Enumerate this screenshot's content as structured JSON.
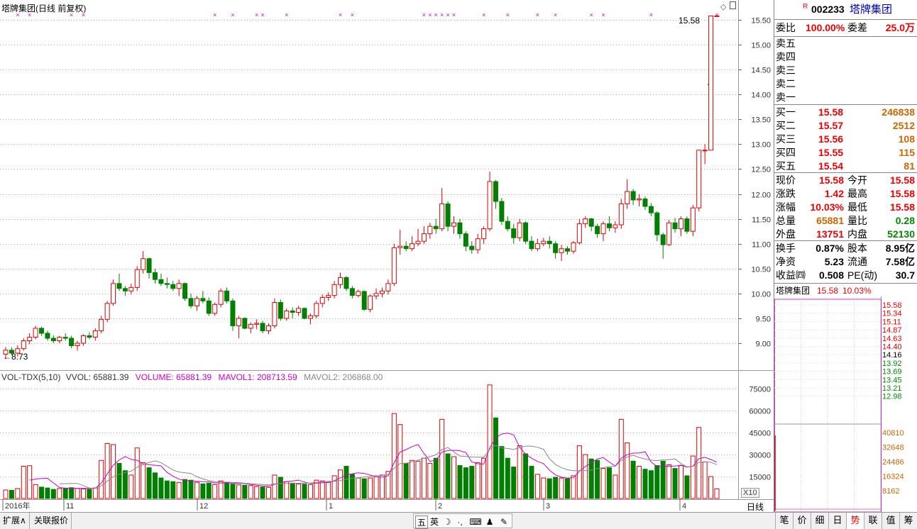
{
  "chart_title": "塔牌集团(日线 前复权)",
  "last_price_tag": "15.58",
  "low_marker": "8.73",
  "price_axis": [
    "15.50",
    "15.00",
    "14.50",
    "14.00",
    "13.50",
    "13.00",
    "12.50",
    "12.00",
    "11.50",
    "11.00",
    "10.50",
    "10.00",
    "9.50",
    "9.00"
  ],
  "volume_axis": [
    "75000",
    "60000",
    "45000",
    "30000",
    "15000"
  ],
  "volume_unit": "X10",
  "volume_legend": {
    "name": "VOL-TDX(5,10)",
    "vvol": "VVOL: 65881.39",
    "volume": "VOLUME: 65881.39",
    "mavol1": "MAVOL1: 208713.59",
    "mavol2": "MAVOL2: 206868.00"
  },
  "date_axis": [
    "2016年",
    "11",
    "12",
    "1",
    "2",
    "3",
    "4"
  ],
  "period_label": "日线",
  "colors": {
    "up": "#e00000",
    "down": "#008000",
    "ma1": "#cc00cc",
    "ma2": "#888888",
    "marker": "#cc00cc"
  },
  "chart_data": {
    "type": "candlestick",
    "title": "塔牌集团(日线 前复权)",
    "ylim": [
      8.6,
      15.65
    ],
    "volume_ylim": [
      0,
      80000
    ],
    "candles": [
      [
        8.78,
        8.92,
        8.7,
        8.86,
        5800
      ],
      [
        8.86,
        8.92,
        8.76,
        8.8,
        5600
      ],
      [
        8.8,
        8.96,
        8.73,
        8.89,
        6800
      ],
      [
        8.89,
        9.1,
        8.85,
        9.05,
        22000
      ],
      [
        9.05,
        9.2,
        8.98,
        9.12,
        22400
      ],
      [
        9.12,
        9.35,
        9.08,
        9.3,
        9500
      ],
      [
        9.3,
        9.33,
        9.15,
        9.2,
        7800
      ],
      [
        9.2,
        9.25,
        9.05,
        9.1,
        7200
      ],
      [
        9.1,
        9.16,
        9.0,
        9.05,
        6200
      ],
      [
        9.05,
        9.15,
        9.0,
        9.12,
        6800
      ],
      [
        9.12,
        9.2,
        9.05,
        9.1,
        7100
      ],
      [
        9.1,
        9.15,
        8.9,
        8.95,
        7400
      ],
      [
        8.95,
        9.05,
        8.85,
        9.0,
        6900
      ],
      [
        9.0,
        9.18,
        8.95,
        9.15,
        6600
      ],
      [
        9.15,
        9.22,
        9.08,
        9.12,
        6300
      ],
      [
        9.12,
        9.3,
        9.05,
        9.25,
        7200
      ],
      [
        9.25,
        9.55,
        9.2,
        9.48,
        26000
      ],
      [
        9.48,
        9.85,
        9.42,
        9.8,
        37500
      ],
      [
        9.8,
        10.28,
        9.75,
        10.2,
        36800
      ],
      [
        10.2,
        10.4,
        10.05,
        10.1,
        24000
      ],
      [
        10.1,
        10.15,
        9.95,
        10.05,
        19000
      ],
      [
        10.05,
        10.2,
        9.98,
        10.12,
        16000
      ],
      [
        10.12,
        10.55,
        10.05,
        10.48,
        34500
      ],
      [
        10.48,
        10.85,
        10.4,
        10.7,
        24500
      ],
      [
        10.7,
        10.72,
        10.3,
        10.42,
        21000
      ],
      [
        10.42,
        10.5,
        10.2,
        10.28,
        17500
      ],
      [
        10.28,
        10.4,
        10.15,
        10.2,
        14000
      ],
      [
        10.2,
        10.32,
        10.1,
        10.18,
        12000
      ],
      [
        10.18,
        10.25,
        10.05,
        10.1,
        11500
      ],
      [
        10.1,
        10.28,
        9.95,
        10.2,
        11000
      ],
      [
        10.2,
        10.22,
        9.85,
        9.9,
        13000
      ],
      [
        9.9,
        10.0,
        9.7,
        9.75,
        12500
      ],
      [
        9.75,
        9.95,
        9.65,
        9.9,
        11000
      ],
      [
        9.9,
        10.05,
        9.8,
        9.85,
        10000
      ],
      [
        9.85,
        9.92,
        9.55,
        9.6,
        10500
      ],
      [
        9.6,
        9.82,
        9.55,
        9.78,
        9500
      ],
      [
        9.78,
        10.1,
        9.72,
        10.05,
        12000
      ],
      [
        10.05,
        10.12,
        9.8,
        9.85,
        11000
      ],
      [
        9.85,
        9.9,
        9.25,
        9.35,
        9800
      ],
      [
        9.35,
        9.55,
        9.1,
        9.5,
        9300
      ],
      [
        9.5,
        9.52,
        9.28,
        9.3,
        9100
      ],
      [
        9.3,
        9.42,
        9.2,
        9.38,
        8800
      ],
      [
        9.38,
        9.48,
        9.28,
        9.4,
        8200
      ],
      [
        9.4,
        9.45,
        9.2,
        9.25,
        7900
      ],
      [
        9.25,
        9.4,
        9.18,
        9.35,
        7600
      ],
      [
        9.35,
        9.9,
        9.3,
        9.82,
        16000
      ],
      [
        9.82,
        9.88,
        9.45,
        9.5,
        14500
      ],
      [
        9.5,
        9.7,
        9.45,
        9.65,
        11500
      ],
      [
        9.65,
        9.72,
        9.5,
        9.62,
        10500
      ],
      [
        9.62,
        9.75,
        9.55,
        9.7,
        10000
      ],
      [
        9.7,
        9.72,
        9.48,
        9.5,
        9800
      ],
      [
        9.5,
        9.6,
        9.38,
        9.55,
        9500
      ],
      [
        9.55,
        9.85,
        9.5,
        9.8,
        12500
      ],
      [
        9.8,
        9.98,
        9.72,
        9.92,
        12000
      ],
      [
        9.92,
        10.02,
        9.85,
        9.96,
        11000
      ],
      [
        9.96,
        10.25,
        9.9,
        10.18,
        15500
      ],
      [
        10.18,
        10.42,
        10.1,
        10.32,
        19500
      ],
      [
        10.32,
        10.35,
        10.05,
        10.1,
        22000
      ],
      [
        10.1,
        10.15,
        9.9,
        9.96,
        16500
      ],
      [
        9.96,
        10.08,
        9.92,
        10.04,
        14000
      ],
      [
        10.04,
        10.06,
        9.65,
        9.68,
        13500
      ],
      [
        9.68,
        9.98,
        9.62,
        9.95,
        14000
      ],
      [
        9.95,
        10.1,
        9.88,
        10.0,
        15500
      ],
      [
        10.0,
        10.12,
        9.92,
        10.05,
        16000
      ],
      [
        10.05,
        10.28,
        9.98,
        10.2,
        18500
      ],
      [
        10.2,
        11.0,
        10.15,
        10.92,
        58000
      ],
      [
        10.92,
        11.28,
        10.78,
        10.95,
        50500
      ],
      [
        10.95,
        11.05,
        10.85,
        10.9,
        24000
      ],
      [
        10.9,
        11.15,
        10.85,
        11.0,
        26000
      ],
      [
        11.0,
        11.3,
        10.95,
        11.05,
        25500
      ],
      [
        11.05,
        11.35,
        11.0,
        11.2,
        27500
      ],
      [
        11.2,
        11.42,
        11.1,
        11.35,
        24000
      ],
      [
        11.35,
        11.5,
        11.2,
        11.3,
        27500
      ],
      [
        11.3,
        12.12,
        11.25,
        11.8,
        54000
      ],
      [
        11.8,
        11.85,
        11.25,
        11.35,
        30500
      ],
      [
        11.35,
        11.55,
        11.2,
        11.42,
        28500
      ],
      [
        11.42,
        11.5,
        11.1,
        11.2,
        22500
      ],
      [
        11.2,
        11.25,
        10.85,
        10.95,
        21000
      ],
      [
        10.95,
        11.05,
        10.8,
        10.88,
        22000
      ],
      [
        10.88,
        11.2,
        10.8,
        11.1,
        24500
      ],
      [
        11.1,
        11.35,
        11.0,
        11.3,
        27500
      ],
      [
        11.3,
        12.45,
        11.25,
        12.25,
        77500
      ],
      [
        12.25,
        12.28,
        11.7,
        11.85,
        55000
      ],
      [
        11.85,
        11.92,
        11.38,
        11.45,
        35500
      ],
      [
        11.45,
        11.55,
        11.25,
        11.3,
        27500
      ],
      [
        11.3,
        11.4,
        11.0,
        11.12,
        21500
      ],
      [
        11.12,
        11.5,
        11.05,
        11.42,
        36000
      ],
      [
        11.42,
        11.45,
        11.0,
        11.05,
        30500
      ],
      [
        11.05,
        11.15,
        10.85,
        10.9,
        22000
      ],
      [
        10.9,
        11.1,
        10.85,
        11.0,
        16500
      ],
      [
        11.0,
        11.12,
        10.95,
        11.05,
        14000
      ],
      [
        11.05,
        11.15,
        10.9,
        11.0,
        13500
      ],
      [
        11.0,
        11.05,
        10.7,
        10.82,
        14500
      ],
      [
        10.82,
        10.98,
        10.65,
        10.9,
        14000
      ],
      [
        10.9,
        10.95,
        10.78,
        10.85,
        13500
      ],
      [
        10.85,
        11.05,
        10.8,
        11.02,
        15500
      ],
      [
        11.02,
        11.5,
        10.98,
        11.4,
        36000
      ],
      [
        11.4,
        11.55,
        11.32,
        11.5,
        30000
      ],
      [
        11.5,
        11.52,
        11.25,
        11.35,
        27000
      ],
      [
        11.35,
        11.4,
        11.12,
        11.2,
        26000
      ],
      [
        11.2,
        11.45,
        11.05,
        11.4,
        20500
      ],
      [
        11.4,
        11.55,
        11.25,
        11.32,
        21000
      ],
      [
        11.32,
        11.45,
        11.22,
        11.38,
        16000
      ],
      [
        11.38,
        11.9,
        11.3,
        11.8,
        54000
      ],
      [
        11.8,
        12.3,
        11.7,
        12.05,
        38000
      ],
      [
        12.05,
        12.1,
        11.78,
        11.88,
        25500
      ],
      [
        11.88,
        12.0,
        11.75,
        11.9,
        22000
      ],
      [
        11.9,
        11.95,
        11.68,
        11.75,
        20000
      ],
      [
        11.75,
        11.82,
        11.55,
        11.62,
        19000
      ],
      [
        11.62,
        11.65,
        11.05,
        11.18,
        22500
      ],
      [
        11.18,
        11.22,
        10.7,
        10.98,
        25500
      ],
      [
        10.98,
        11.48,
        10.95,
        11.42,
        23000
      ],
      [
        11.42,
        11.52,
        11.22,
        11.3,
        20500
      ],
      [
        11.3,
        11.55,
        11.15,
        11.5,
        22500
      ],
      [
        11.5,
        11.55,
        11.2,
        11.25,
        15500
      ],
      [
        11.25,
        11.78,
        11.15,
        11.72,
        29000
      ],
      [
        11.72,
        12.88,
        11.65,
        12.88,
        48500
      ],
      [
        12.88,
        13.0,
        12.6,
        12.88,
        25000
      ],
      [
        12.88,
        15.58,
        12.88,
        15.58,
        15000
      ],
      [
        15.58,
        15.58,
        15.58,
        15.58,
        6588
      ]
    ],
    "top_markers": "purple x markers along top edge"
  },
  "right_panel": {
    "code": "002233",
    "name": "塔牌集团",
    "r_badge": "R",
    "weibi_label": "委比",
    "weibi": "100.00%",
    "weicha_label": "委差",
    "weicha": "25.0万",
    "sells": [
      "卖五",
      "卖四",
      "卖三",
      "卖二",
      "卖一"
    ],
    "buys": [
      {
        "label": "买一",
        "price": "15.58",
        "vol": "246838"
      },
      {
        "label": "买二",
        "price": "15.57",
        "vol": "2512"
      },
      {
        "label": "买三",
        "price": "15.56",
        "vol": "108"
      },
      {
        "label": "买四",
        "price": "15.55",
        "vol": "115"
      },
      {
        "label": "买五",
        "price": "15.54",
        "vol": "81"
      }
    ],
    "stats": [
      {
        "l1": "现价",
        "v1": "15.58",
        "l2": "今开",
        "v2": "15.58"
      },
      {
        "l1": "涨跌",
        "v1": "1.42",
        "l2": "最高",
        "v2": "15.58"
      },
      {
        "l1": "涨幅",
        "v1": "10.03%",
        "l2": "最低",
        "v2": "15.58"
      },
      {
        "l1": "总量",
        "v1": "65881",
        "l2": "量比",
        "v2": "0.28"
      },
      {
        "l1": "外盘",
        "v1": "13751",
        "l2": "内盘",
        "v2": "52130"
      }
    ],
    "fund": [
      {
        "l1": "换手",
        "v1": "0.87%",
        "l2": "股本",
        "v2": "8.95亿"
      },
      {
        "l1": "净资",
        "v1": "5.23",
        "l2": "流通",
        "v2": "7.58亿"
      },
      {
        "l1": "收益㈣",
        "v1": "0.508",
        "l2": "PE(动)",
        "v2": "30.7"
      }
    ],
    "mini_title": "塔牌集团",
    "mini_price": "15.58",
    "mini_pct": "10.03%",
    "mini_axis_red": [
      "15.58",
      "15.34",
      "15.11",
      "14.87",
      "14.63",
      "14.40"
    ],
    "mini_axis_mid": "14.16",
    "mini_axis_green": [
      "13.92",
      "13.69",
      "13.45",
      "13.21",
      "12.98"
    ],
    "mini_vol_axis": [
      "40810",
      "32648",
      "24486",
      "16324",
      "8162"
    ]
  },
  "bottom_bar": {
    "tabs": [
      "扩展∧",
      "关联报价"
    ],
    "ime": [
      "五",
      "英",
      "☽",
      "·,",
      "⌨",
      "♟",
      "✎"
    ],
    "right_tabs": [
      "笔",
      "价",
      "细",
      "日",
      "势",
      "联",
      "值",
      "筹"
    ]
  }
}
